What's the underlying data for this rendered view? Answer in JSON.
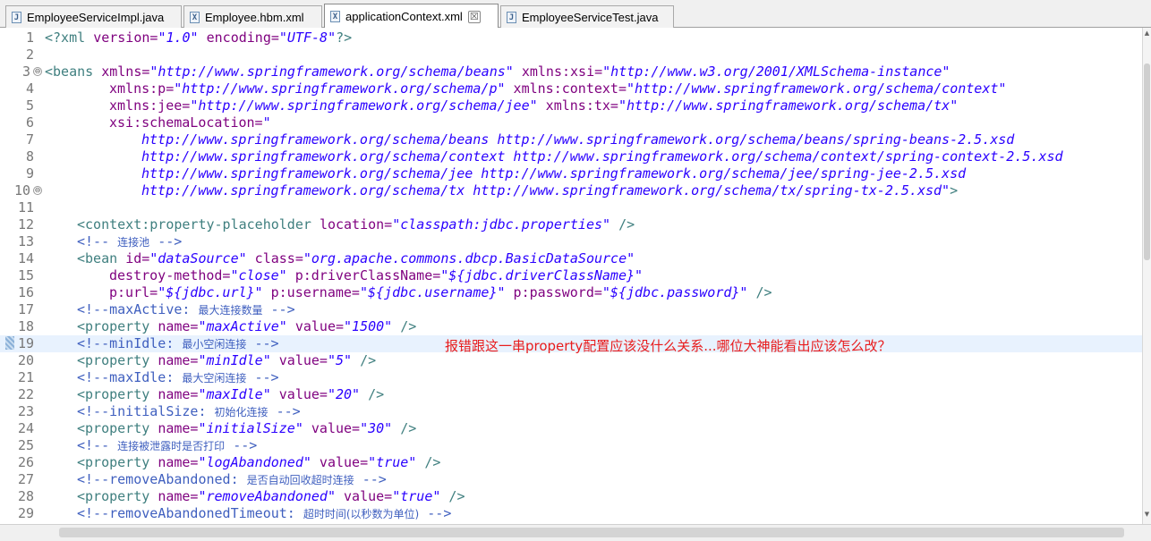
{
  "tabs": [
    {
      "label": "EmployeeServiceImpl.java",
      "icon": "J",
      "active": false
    },
    {
      "label": "Employee.hbm.xml",
      "icon": "X",
      "active": false
    },
    {
      "label": "applicationContext.xml",
      "icon": "X",
      "active": true,
      "close": "☒"
    },
    {
      "label": "EmployeeServiceTest.java",
      "icon": "J",
      "active": false
    }
  ],
  "lines": [
    {
      "n": "1"
    },
    {
      "n": "2"
    },
    {
      "n": "3"
    },
    {
      "n": "4"
    },
    {
      "n": "5"
    },
    {
      "n": "6"
    },
    {
      "n": "7"
    },
    {
      "n": "8"
    },
    {
      "n": "9"
    },
    {
      "n": "10"
    },
    {
      "n": "11"
    },
    {
      "n": "12"
    },
    {
      "n": "13"
    },
    {
      "n": "14"
    },
    {
      "n": "15"
    },
    {
      "n": "16"
    },
    {
      "n": "17"
    },
    {
      "n": "18"
    },
    {
      "n": "19"
    },
    {
      "n": "20"
    },
    {
      "n": "21"
    },
    {
      "n": "22"
    },
    {
      "n": "23"
    },
    {
      "n": "24"
    },
    {
      "n": "25"
    },
    {
      "n": "26"
    },
    {
      "n": "27"
    },
    {
      "n": "28"
    },
    {
      "n": "29"
    }
  ],
  "code": {
    "l1": {
      "a": "<?xml ",
      "b": "version=",
      "c": "\"1.0\"",
      "d": " encoding=",
      "e": "\"UTF-8\"",
      "f": "?>"
    },
    "l3": {
      "a": "<beans ",
      "b": "xmlns=",
      "c": "\"http://www.springframework.org/schema/beans\"",
      "d": " xmlns:xsi=",
      "e": "\"http://www.w3.org/2001/XMLSchema-instance\""
    },
    "l4": {
      "b": "xmlns:p=",
      "c": "\"http://www.springframework.org/schema/p\"",
      "d": " xmlns:context=",
      "e": "\"http://www.springframework.org/schema/context\""
    },
    "l5": {
      "b": "xmlns:jee=",
      "c": "\"http://www.springframework.org/schema/jee\"",
      "d": " xmlns:tx=",
      "e": "\"http://www.springframework.org/schema/tx\""
    },
    "l6": {
      "b": "xsi:schemaLocation=",
      "c": "\""
    },
    "l7": "http://www.springframework.org/schema/beans http://www.springframework.org/schema/beans/spring-beans-2.5.xsd",
    "l8": "http://www.springframework.org/schema/context http://www.springframework.org/schema/context/spring-context-2.5.xsd",
    "l9": "http://www.springframework.org/schema/jee http://www.springframework.org/schema/jee/spring-jee-2.5.xsd",
    "l10": {
      "v": "http://www.springframework.org/schema/tx http://www.springframework.org/schema/tx/spring-tx-2.5.xsd\"",
      "t": ">"
    },
    "l12": {
      "a": "<context:property-placeholder ",
      "b": "location=",
      "c": "\"classpath:jdbc.properties\"",
      "t": " />"
    },
    "l13": {
      "a": "<!-- ",
      "cn": "连接池",
      "z": " -->"
    },
    "l14": {
      "a": "<bean ",
      "b": "id=",
      "c": "\"dataSource\"",
      "d": " class=",
      "e": "\"org.apache.commons.dbcp.BasicDataSource\""
    },
    "l15": {
      "b": "destroy-method=",
      "c": "\"close\"",
      "d": " p:driverClassName=",
      "e": "\"${jdbc.driverClassName}\""
    },
    "l16": {
      "b": "p:url=",
      "c": "\"${jdbc.url}\"",
      "d": " p:username=",
      "e": "\"${jdbc.username}\"",
      "f": " p:password=",
      "g": "\"${jdbc.password}\"",
      "t": " />"
    },
    "l17": {
      "a": "<!--maxActive: ",
      "cn": "最大连接数量",
      "z": " -->"
    },
    "l18": {
      "a": "<property ",
      "b": "name=",
      "c": "\"maxActive\"",
      "d": " value=",
      "e": "\"1500\"",
      "t": " />"
    },
    "l19": {
      "a": "<!--minIdle: ",
      "cn": "最小空闲连接",
      "z": " -->"
    },
    "l20": {
      "a": "<property ",
      "b": "name=",
      "c": "\"minIdle\"",
      "d": " value=",
      "e": "\"5\"",
      "t": " />"
    },
    "l21": {
      "a": "<!--maxIdle: ",
      "cn": "最大空闲连接",
      "z": " -->"
    },
    "l22": {
      "a": "<property ",
      "b": "name=",
      "c": "\"maxIdle\"",
      "d": " value=",
      "e": "\"20\"",
      "t": " />"
    },
    "l23": {
      "a": "<!--initialSize: ",
      "cn": "初始化连接",
      "z": " -->"
    },
    "l24": {
      "a": "<property ",
      "b": "name=",
      "c": "\"initialSize\"",
      "d": " value=",
      "e": "\"30\"",
      "t": " />"
    },
    "l25": {
      "a": "<!-- ",
      "cn": "连接被泄露时是否打印",
      "z": " -->"
    },
    "l26": {
      "a": "<property ",
      "b": "name=",
      "c": "\"logAbandoned\"",
      "d": " value=",
      "e": "\"true\"",
      "t": " />"
    },
    "l27": {
      "a": "<!--removeAbandoned: ",
      "cn": "是否自动回收超时连接",
      "z": " -->"
    },
    "l28": {
      "a": "<property ",
      "b": "name=",
      "c": "\"removeAbandoned\"",
      "d": " value=",
      "e": "\"true\"",
      "t": " />"
    },
    "l29": {
      "a": "<!--removeAbandonedTimeout: ",
      "cn": "超时时间(以秒数为单位)",
      "z": " -->"
    }
  },
  "fold_glyph": "⊖",
  "annotation": "报错跟这一串property配置应该没什么关系...哪位大神能看出应该怎么改？",
  "colors": {
    "tag": "#3f7f7f",
    "attr": "#7f007f",
    "value": "#2a00ff",
    "comment": "#3f5fbf",
    "annotation": "#e81c1c",
    "current_line": "#e8f2fe"
  }
}
